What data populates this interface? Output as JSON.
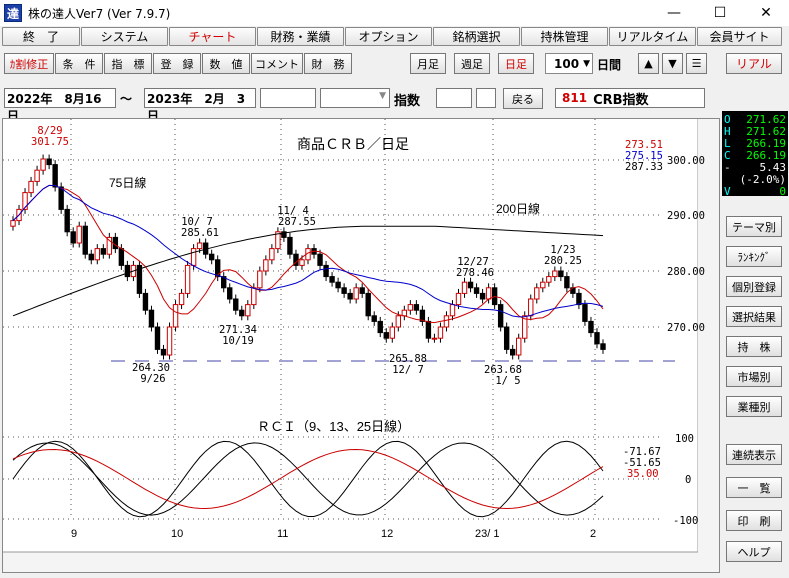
{
  "window": {
    "title": "株の達人Ver7 (Ver 7.9.7)",
    "app_icon": "達",
    "minimize": "—",
    "maximize": "☐",
    "close": "✕"
  },
  "menu": [
    "終　了",
    "システム",
    "チャート",
    "財務・業績",
    "オプション",
    "銘柄選択",
    "持株管理",
    "リアルタイム",
    "会員サイト"
  ],
  "toolbar": {
    "left": [
      "ｶ割修正",
      "条　件",
      "指　標",
      "登　録",
      "数　値",
      "コメント",
      "財　務"
    ],
    "periods": [
      "月足",
      "週足",
      "日足"
    ],
    "count": "100",
    "count_unit": "日間",
    "up": "▲",
    "down": "▼",
    "menu": "☰",
    "realtime": "リアル"
  },
  "datebar": {
    "from": "2022年　8月16日",
    "tilde": "～",
    "to": "2023年　2月　3日",
    "index_label": "指数",
    "back": "戻る",
    "code": "811",
    "name": "CRB指数"
  },
  "quote": {
    "o_label": "O",
    "o": "271.62",
    "h_label": "H",
    "h": "271.62",
    "l_label": "L",
    "l": "266.19",
    "c_label": "C",
    "c": "266.19",
    "chg_label": "-",
    "chg": "5.43",
    "pct": "(-2.0%)",
    "v_label": "V",
    "v": "0"
  },
  "sidebar": [
    "テーマ別",
    "ﾗﾝｷﾝｸﾞ",
    "個別登録",
    "選択結果",
    "持　株",
    "市場別",
    "業種別",
    "連続表示",
    "一　覧",
    "印　刷",
    "ヘルプ"
  ],
  "chart_data": {
    "type": "candlestick",
    "title": "商品ＣＲＢ／日足",
    "y_range": [
      262,
      304
    ],
    "y_ticks": [
      "300.00",
      "290.00",
      "280.00",
      "270.00"
    ],
    "x_ticks": [
      "9",
      "10",
      "11",
      "12",
      "23/ 1",
      "2"
    ],
    "ma_labels": [
      "75日線",
      "200日線"
    ],
    "ma_values": [
      "273.51",
      "275.15",
      "287.33"
    ],
    "ma_colors": [
      "#cc0000",
      "#0000cc",
      "#000000"
    ],
    "annotations": [
      {
        "date": "8/29",
        "value": "301.75"
      },
      {
        "date": "9/26",
        "value": "264.30"
      },
      {
        "date": "10/ 7",
        "value": "285.61"
      },
      {
        "date": "10/19",
        "value": "271.34"
      },
      {
        "date": "11/ 4",
        "value": "287.55"
      },
      {
        "date": "12/ 7",
        "value": "265.88"
      },
      {
        "date": "12/27",
        "value": "278.46"
      },
      {
        "date": "1/ 5",
        "value": "263.68"
      },
      {
        "date": "1/23",
        "value": "280.25"
      }
    ],
    "rci": {
      "title": "ＲＣＩ（9、13、25日線）",
      "y_ticks": [
        "100",
        "0",
        "-100"
      ],
      "values": [
        "-71.67",
        "-51.65",
        "35.00"
      ],
      "colors": [
        "#000000",
        "#000000",
        "#cc0000"
      ]
    }
  }
}
